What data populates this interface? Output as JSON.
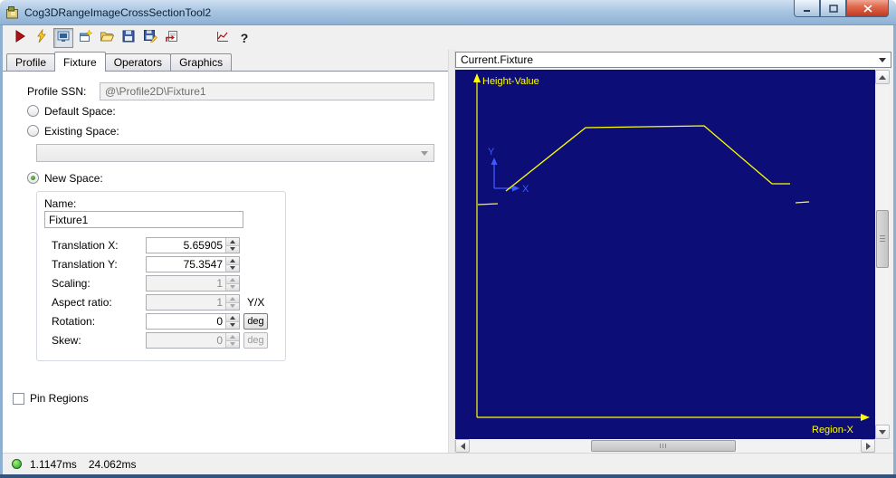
{
  "window": {
    "title": "Cog3DRangeImageCrossSectionTool2"
  },
  "toolbar": {
    "help_glyph": "?",
    "buttons": [
      {
        "name": "run-button",
        "icon": "play-icon"
      },
      {
        "name": "electric-run-button",
        "icon": "lightning-icon"
      },
      {
        "name": "display-toggle-button",
        "icon": "monitor-icon",
        "pressed": true
      },
      {
        "name": "new-window-button",
        "icon": "window-new-icon"
      },
      {
        "name": "open-file-button",
        "icon": "folder-open-icon"
      },
      {
        "name": "save-button",
        "icon": "floppy-icon"
      },
      {
        "name": "save-as-button",
        "icon": "floppy-pencil-icon"
      },
      {
        "name": "import-button",
        "icon": "import-page-icon"
      },
      {
        "name": "profile-scope-button",
        "icon": "scope-icon"
      },
      {
        "name": "help-button",
        "icon": "question-icon"
      }
    ]
  },
  "tabs": [
    {
      "label": "Profile",
      "active": false
    },
    {
      "label": "Fixture",
      "active": true
    },
    {
      "label": "Operators",
      "active": false
    },
    {
      "label": "Graphics",
      "active": false
    }
  ],
  "fixture_panel": {
    "profile_ssn_label": "Profile SSN:",
    "profile_ssn_value": "@\\Profile2D\\Fixture1",
    "default_space_label": "Default Space:",
    "existing_space_label": "Existing Space:",
    "existing_space_value": "",
    "new_space_label": "New Space:",
    "name_label": "Name:",
    "name_value": "Fixture1",
    "rows": [
      {
        "label": "Translation X:",
        "value": "5.65905",
        "enabled": true,
        "suffix": ""
      },
      {
        "label": "Translation Y:",
        "value": "75.3547",
        "enabled": true,
        "suffix": ""
      },
      {
        "label": "Scaling:",
        "value": "1",
        "enabled": false,
        "suffix": ""
      },
      {
        "label": "Aspect ratio:",
        "value": "1",
        "enabled": false,
        "suffix": "Y/X"
      },
      {
        "label": "Rotation:",
        "value": "0",
        "enabled": true,
        "suffix": "deg"
      },
      {
        "label": "Skew:",
        "value": "0",
        "enabled": false,
        "suffix": "deg"
      }
    ],
    "pin_regions_label": "Pin Regions"
  },
  "display_panel": {
    "selector_value": "Current.Fixture",
    "plot": {
      "background": "#0d0d78",
      "axis_color": "#ffff00",
      "profile_color": "#ffff00",
      "marker_color": "#3b5bff",
      "y_axis_label": "Height-Value",
      "x_axis_label": "Region-X",
      "marker": {
        "x_label": "X",
        "y_label": "Y"
      },
      "profile_segments": [
        [
          [
            25,
            149
          ],
          [
            47,
            148
          ]
        ],
        [
          [
            56,
            134
          ],
          [
            144,
            64
          ],
          [
            275,
            62
          ],
          [
            350,
            126
          ],
          [
            370,
            126
          ]
        ],
        [
          [
            376,
            147
          ],
          [
            391,
            146
          ]
        ]
      ]
    }
  },
  "status_bar": {
    "led_color": "#1fa01f",
    "time1": "1.1147ms",
    "time2": "24.062ms"
  }
}
